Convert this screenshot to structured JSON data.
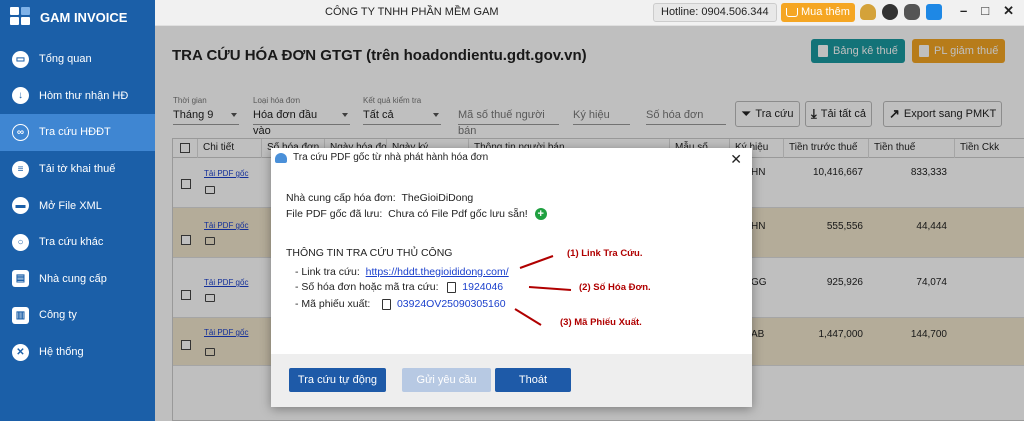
{
  "app": {
    "name": "GAM INVOICE"
  },
  "sidebar": {
    "items": [
      {
        "label": "Tổng quan",
        "active": false
      },
      {
        "label": "Hòm thư nhận HĐ",
        "active": false
      },
      {
        "label": "Tra cứu HĐĐT",
        "active": true
      },
      {
        "label": "Tải tờ khai thuế",
        "active": false
      },
      {
        "label": "Mở File XML",
        "active": false
      },
      {
        "label": "Tra cứu khác",
        "active": false
      },
      {
        "label": "Nhà cung cấp",
        "active": false
      },
      {
        "label": "Công ty",
        "active": false
      },
      {
        "label": "Hệ thống",
        "active": false
      }
    ]
  },
  "topbar": {
    "company": "CÔNG TY TNHH PHẦN MỀM GAM",
    "hotline": "Hotline: 0904.506.344",
    "buy_more": "Mua thêm"
  },
  "page": {
    "title": "TRA CỨU HÓA ĐƠN GTGT (trên hoadondientu.gdt.gov.vn)",
    "bang_ke_thue": "Bảng kê thuế",
    "pl_giam_thue": "PL giảm thuế"
  },
  "filters": {
    "period_label": "Thời gian",
    "period_value": "Tháng 9",
    "type_label": "Loại hóa đơn",
    "type_value": "Hóa đơn đầu vào",
    "check_label": "Kết quả kiểm tra",
    "check_value": "Tất cả",
    "tax_code_placeholder": "Mã số thuế người bán",
    "symbol_placeholder": "Ký hiệu",
    "invoice_no_placeholder": "Số hóa đơn"
  },
  "toolbar": {
    "search": "Tra cứu",
    "download_all": "Tải tất cả",
    "export": "Export sang PMKT"
  },
  "grid": {
    "columns": [
      "Chi tiết",
      "Số hóa đơn",
      "Ngày hóa đơn",
      "Ngày ký",
      "Thông tin người bán",
      "Mẫu số",
      "Ký hiệu",
      "Tiền trước thuế",
      "Tiền thuế",
      "Tiền Ckk"
    ],
    "link_label": "Tải PDF gốc",
    "rows": [
      {
        "symbol": "HN",
        "pretax": "10,416,667",
        "tax": "833,333"
      },
      {
        "symbol": "HN",
        "pretax": "555,556",
        "tax": "44,444"
      },
      {
        "symbol": "GG",
        "pretax": "925,926",
        "tax": "74,074"
      },
      {
        "symbol": "AB",
        "pretax": "1,447,000",
        "tax": "144,700"
      }
    ]
  },
  "dialog": {
    "title": "Tra cứu PDF gốc từ nhà phát hành hóa đơn",
    "provider_label": "Nhà cung cấp hóa đơn:",
    "provider_value": "TheGioiDiDong",
    "saved_label": "File PDF gốc đã lưu:",
    "saved_value": "Chưa có File Pdf gốc lưu sẵn!",
    "manual_heading": "THÔNG TIN TRA CỨU THỦ CÔNG",
    "link_label": "- Link tra cứu:",
    "link_value": "https://hddt.thegioididong.com/",
    "invoice_label": "- Số hóa đơn hoặc mã tra cứu:",
    "invoice_value": "1924046",
    "slip_label": "- Mã phiếu xuất:",
    "slip_value": "03924OV25090305160",
    "btn_auto": "Tra cứu tự động",
    "btn_send": "Gửi yêu cầu",
    "btn_exit": "Thoát"
  },
  "annotations": [
    "(1) Link Tra Cứu.",
    "(2) Số Hóa Đơn.",
    "(3) Mã Phiếu Xuất."
  ],
  "colors": {
    "sidebar": "#1b5fa8",
    "active": "#3f86d2",
    "teal": "#1a9aa0",
    "orange": "#f5a623",
    "button_blue": "#1e5aa8",
    "link": "#1a3fcc",
    "annotation": "#b00000"
  }
}
